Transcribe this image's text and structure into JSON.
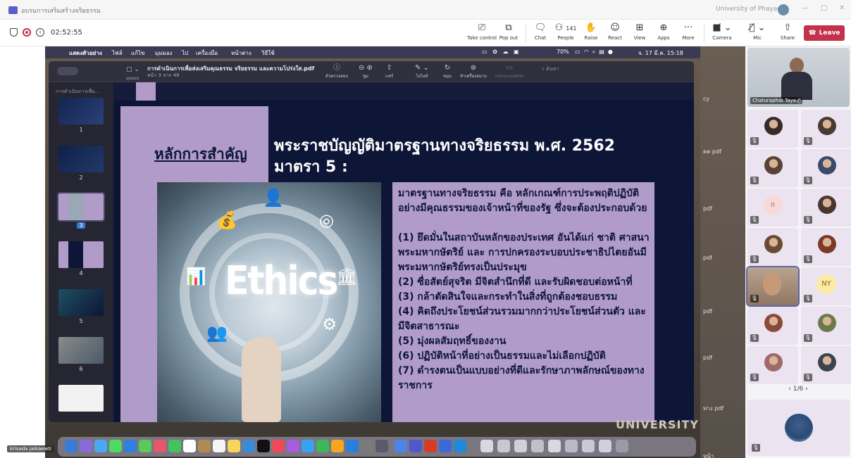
{
  "window": {
    "title": "อบรมการเสริมสร้างจริยธรรม",
    "org_name": "University of Phayao",
    "controls": [
      "—",
      "▢",
      "✕"
    ]
  },
  "meeting": {
    "timer": "02:52:55",
    "buttons": [
      {
        "icon": "take-control-icon",
        "label": "Take control"
      },
      {
        "icon": "pop-out-icon",
        "label": "Pop out"
      },
      {
        "icon": "chat-icon",
        "label": "Chat"
      },
      {
        "icon": "people-icon",
        "label": "People",
        "count": "141"
      },
      {
        "icon": "raise-hand-icon",
        "label": "Raise"
      },
      {
        "icon": "react-icon",
        "label": "React"
      },
      {
        "icon": "view-icon",
        "label": "View"
      },
      {
        "icon": "apps-icon",
        "label": "Apps"
      },
      {
        "icon": "more-icon",
        "label": "More"
      },
      {
        "icon": "camera-off-icon",
        "label": "Camera"
      },
      {
        "icon": "mic-off-icon",
        "label": "Mic"
      },
      {
        "icon": "share-icon",
        "label": "Share"
      }
    ],
    "leave_label": "Leave"
  },
  "mac": {
    "menu": [
      "แสดงตัวอย่าง",
      "ไฟล์",
      "แก้ไข",
      "มุมมอง",
      "ไป",
      "เครื่องมือ",
      "หน้าต่าง",
      "วิธีใช้"
    ],
    "battery": "70%",
    "clock": "จ. 17 มี.ค. 15:18"
  },
  "preview": {
    "doc_title": "การดำเนินการเพื่อส่งเสริมคุณธรรม จริยธรรม และความโปร่งใส.pdf",
    "page_info": "หน้า 3 จาก 48",
    "sidebar_label": "การดำเนินการเพื่อ...",
    "search_placeholder": "ค้นหา",
    "tools": [
      "ตัวตรวจสอบ",
      "ซูม",
      "แชร์",
      "ไฮไลท์",
      "หมุน",
      "ทำเครื่องหมาย",
      "กรอกแบบฟอร์ม"
    ],
    "view_label": "มุมมอง",
    "thumb_numbers": [
      "1",
      "2",
      "3",
      "4",
      "5",
      "6"
    ],
    "selected_page": "3"
  },
  "slide": {
    "tab_heading": "หลักการสำคัญ",
    "title_line1": "พระราชบัญญัติมาตรฐานทางจริยธรรม พ.ศ. 2562",
    "title_line2": "มาตรา 5 :",
    "image_word": "Ethics",
    "intro": "มาตรฐานทางจริยธรรม คือ หลักเกณฑ์การประพฤติปฏิบัติอย่างมีคุณธรรมของเจ้าหน้าที่ของรัฐ ซึ่งจะต้องประกอบด้วย",
    "items": [
      "(1) ยึดมั่นในสถาบันหลักของประเทศ อันได้แก่ ชาติ ศาสนา พระมหากษัตริย์ และ การปกครองระบอบประชาธิปไตยอันมีพระมหากษัตริย์ทรงเป็นประมุข",
      "(2) ซื่อสัตย์สุจริต มีจิตสำนึกที่ดี และรับผิดชอบต่อหน้าที่",
      "(3) กล้าตัดสินใจและกระทำในสิ่งที่ถูกต้องชอบธรรม",
      "(4) คิดถึงประโยชน์ส่วนรวมมากกว่าประโยชน์ส่วนตัว และมีจิตสาธารณะ",
      "(5) มุ่งผลสัมฤทธิ์ของงาน",
      "(6) ปฏิบัติหน้าที่อย่างเป็นธรรมและไม่เลือกปฏิบัติ",
      "(7) ดำรงตนเป็นแบบอย่างที่ดีและรักษาภาพลักษณ์ของทางราชการ"
    ]
  },
  "desktop": {
    "university_text": "UNIVERSITY",
    "edge_labels": [
      "cy",
      "ดต pdf",
      "pdf",
      "pdf",
      "pdf",
      "pdf",
      "ทาง pdf",
      "หน้า"
    ]
  },
  "participants": {
    "speaker_name": "Chaturaphat Taya",
    "tiles": [
      {
        "type": "photo",
        "color": "#3a2b2b"
      },
      {
        "type": "photo",
        "color": "#4a3a33"
      },
      {
        "type": "photo",
        "color": "#5a4236"
      },
      {
        "type": "photo",
        "color": "#3b4a6a"
      },
      {
        "type": "initial",
        "text": "ก",
        "bg": "#f6dada",
        "fg": "#b65050"
      },
      {
        "type": "photo",
        "color": "#4a3530"
      },
      {
        "type": "photo",
        "color": "#6a4a33"
      },
      {
        "type": "photo",
        "color": "#7a3a26"
      },
      {
        "type": "video",
        "selected": true
      },
      {
        "type": "initial",
        "text": "NY",
        "bg": "#fbe9a6",
        "fg": "#8a6a10"
      },
      {
        "type": "photo",
        "color": "#8a4a3a"
      },
      {
        "type": "photo",
        "color": "#6b7a4a"
      },
      {
        "type": "photo",
        "color": "#a06a6a"
      },
      {
        "type": "photo",
        "color": "#3a4450"
      }
    ],
    "pager": "1/6",
    "local_name": "krisada jaikaewti"
  }
}
